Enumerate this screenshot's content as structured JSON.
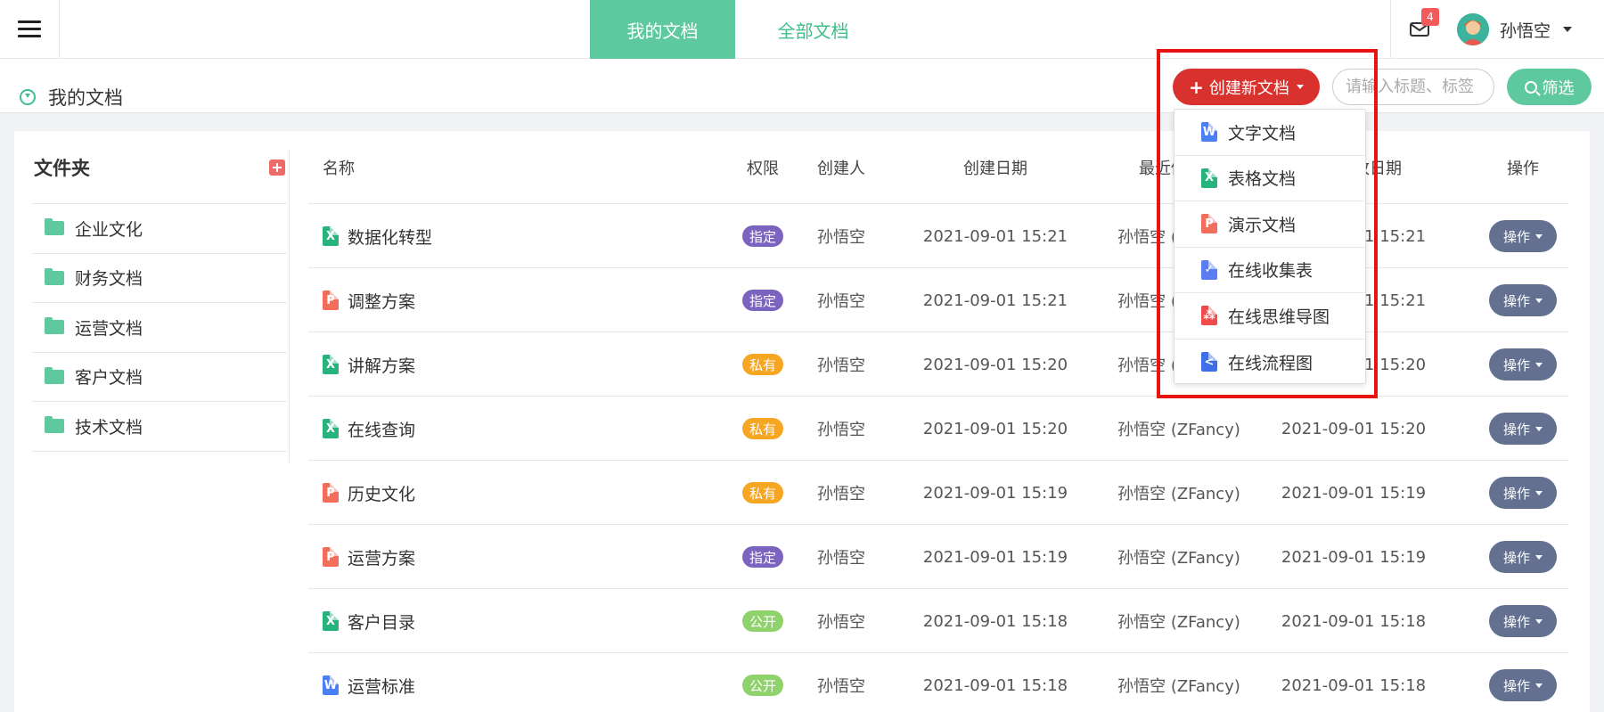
{
  "header": {
    "tabs": [
      {
        "label": "我的文档",
        "active": true
      },
      {
        "label": "全部文档",
        "active": false
      }
    ],
    "mail_count": "4",
    "username": "孙悟空"
  },
  "subheader": {
    "breadcrumb": "我的文档",
    "create_button": "创建新文档",
    "search_placeholder": "请输入标题、标签",
    "filter_button": "筛选"
  },
  "sidebar": {
    "title": "文件夹",
    "folders": [
      "企业文化",
      "财务文档",
      "运营文档",
      "客户文档",
      "技术文档"
    ]
  },
  "table": {
    "headers": {
      "name": "名称",
      "perm": "权限",
      "creator": "创建人",
      "cdate": "创建日期",
      "modifier": "最近修改人",
      "mdate": "最近修改日期",
      "op": "操作"
    },
    "rows": [
      {
        "icon": "xls",
        "name": "数据化转型",
        "perm": "指定",
        "creator": "孙悟空",
        "cdate": "2021-09-01 15:21",
        "modifier": "孙悟空 (ZFancy)",
        "mdate": "2021-09-01 15:21",
        "op": "操作"
      },
      {
        "icon": "ppt",
        "name": "调整方案",
        "perm": "指定",
        "creator": "孙悟空",
        "cdate": "2021-09-01 15:21",
        "modifier": "孙悟空 (ZFancy)",
        "mdate": "2021-09-01 15:21",
        "op": "操作"
      },
      {
        "icon": "xls",
        "name": "讲解方案",
        "perm": "私有",
        "creator": "孙悟空",
        "cdate": "2021-09-01 15:20",
        "modifier": "孙悟空 (ZFancy)",
        "mdate": "2021-09-01 15:20",
        "op": "操作"
      },
      {
        "icon": "xls",
        "name": "在线查询",
        "perm": "私有",
        "creator": "孙悟空",
        "cdate": "2021-09-01 15:20",
        "modifier": "孙悟空 (ZFancy)",
        "mdate": "2021-09-01 15:20",
        "op": "操作"
      },
      {
        "icon": "ppt",
        "name": "历史文化",
        "perm": "私有",
        "creator": "孙悟空",
        "cdate": "2021-09-01 15:19",
        "modifier": "孙悟空 (ZFancy)",
        "mdate": "2021-09-01 15:19",
        "op": "操作"
      },
      {
        "icon": "ppt",
        "name": "运营方案",
        "perm": "指定",
        "creator": "孙悟空",
        "cdate": "2021-09-01 15:19",
        "modifier": "孙悟空 (ZFancy)",
        "mdate": "2021-09-01 15:19",
        "op": "操作"
      },
      {
        "icon": "xls",
        "name": "客户目录",
        "perm": "公开",
        "creator": "孙悟空",
        "cdate": "2021-09-01 15:18",
        "modifier": "孙悟空 (ZFancy)",
        "mdate": "2021-09-01 15:18",
        "op": "操作"
      },
      {
        "icon": "doc",
        "name": "运营标准",
        "perm": "公开",
        "creator": "孙悟空",
        "cdate": "2021-09-01 15:18",
        "modifier": "孙悟空 (ZFancy)",
        "mdate": "2021-09-01 15:18",
        "op": "操作"
      }
    ]
  },
  "dropdown": {
    "items": [
      {
        "icon": "doc",
        "label": "文字文档"
      },
      {
        "icon": "xls",
        "label": "表格文档"
      },
      {
        "icon": "ppt",
        "label": "演示文档"
      },
      {
        "icon": "form",
        "label": "在线收集表"
      },
      {
        "icon": "mind",
        "label": "在线思维导图"
      },
      {
        "icon": "flow",
        "label": "在线流程图"
      }
    ]
  },
  "colors": {
    "accent": "#5ec99e",
    "create": "#d9312e",
    "perm_指定": "#7b64c0",
    "perm_私有": "#f7a623",
    "perm_公开": "#8fd16a",
    "icon_doc": "#4a7ff5",
    "icon_xls": "#26b37c",
    "icon_ppt": "#f26d5b",
    "icon_form": "#5b7df2",
    "icon_mind": "#f04b4b",
    "icon_flow": "#3f6fe8"
  }
}
